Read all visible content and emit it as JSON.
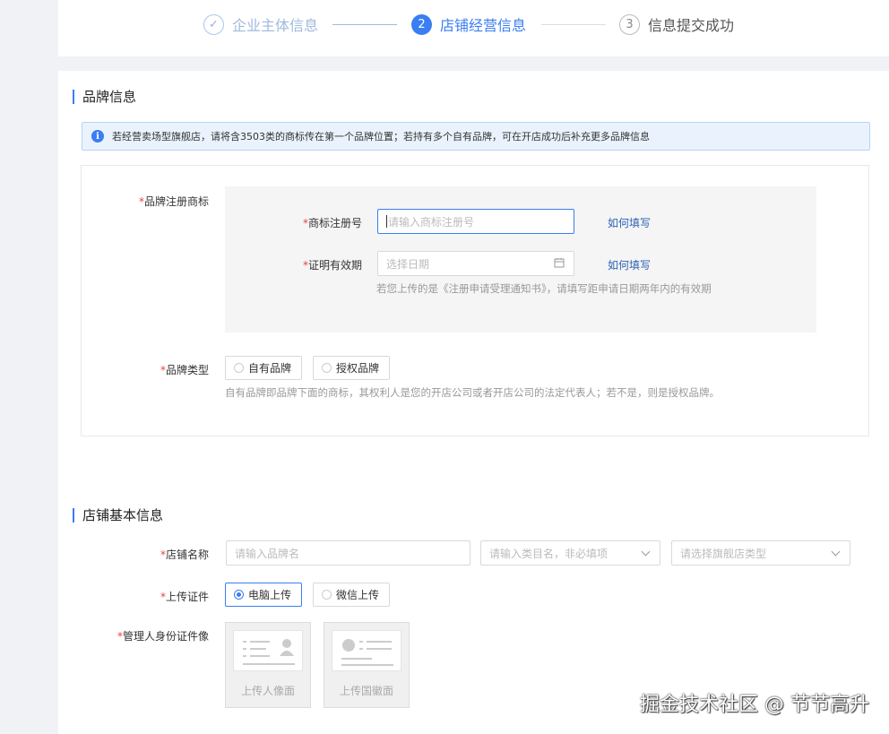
{
  "steps": [
    {
      "index": "✓",
      "label": "企业主体信息",
      "state": "done"
    },
    {
      "index": "2",
      "label": "店铺经营信息",
      "state": "active"
    },
    {
      "index": "3",
      "label": "信息提交成功",
      "state": "pending"
    }
  ],
  "brand_section": {
    "title": "品牌信息",
    "alert": "若经营卖场型旗舰店，请将含3503类的商标传在第一个品牌位置；若持有多个自有品牌，可在开店成功后补充更多品牌信息",
    "trademark_label": "品牌注册商标",
    "reg_no_label": "商标注册号",
    "reg_no_placeholder": "请输入商标注册号",
    "reg_no_link": "如何填写",
    "validity_label": "证明有效期",
    "validity_placeholder": "选择日期",
    "validity_link": "如何填写",
    "validity_hint": "若您上传的是《注册申请受理通知书》，请填写距申请日期两年内的有效期",
    "brand_type_label": "品牌类型",
    "brand_type_options": [
      "自有品牌",
      "授权品牌"
    ],
    "brand_type_hint": "自有品牌即品牌下面的商标，其权利人是您的开店公司或者开店公司的法定代表人；若不是，则是授权品牌。"
  },
  "store_section": {
    "title": "店铺基本信息",
    "store_name_label": "店铺名称",
    "brand_name_placeholder": "请输入品牌名",
    "category_placeholder": "请输入类目名，非必填项",
    "flagship_type_placeholder": "请选择旗舰店类型",
    "upload_cert_label": "上传证件",
    "upload_options": [
      "电脑上传",
      "微信上传"
    ],
    "upload_selected": "电脑上传",
    "id_photo_label": "管理人身份证件像",
    "id_front_label": "上传人像面",
    "id_back_label": "上传国徽面"
  },
  "watermark": "掘金技术社区 @ 节节高升",
  "colors": {
    "accent": "#3a7ef2",
    "required": "#f04040",
    "link": "#2d62b5"
  }
}
